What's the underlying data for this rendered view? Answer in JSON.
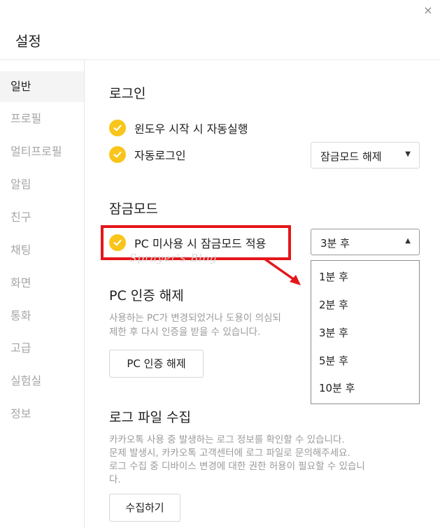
{
  "window": {
    "title": "설정",
    "close_icon": "×"
  },
  "sidebar": {
    "items": [
      {
        "label": "일반"
      },
      {
        "label": "프로필"
      },
      {
        "label": "멀티프로필"
      },
      {
        "label": "알림"
      },
      {
        "label": "친구"
      },
      {
        "label": "채팅"
      },
      {
        "label": "화면"
      },
      {
        "label": "통화"
      },
      {
        "label": "고급"
      },
      {
        "label": "실험실"
      },
      {
        "label": "정보"
      }
    ],
    "active": "일반"
  },
  "login": {
    "title": "로그인",
    "auto_run_label": "윈도우 시작 시 자동실행",
    "auto_login_label": "자동로그인",
    "auto_login_select": "잠금모드 해제"
  },
  "lock": {
    "title": "잠금모드",
    "pc_idle_label": "PC 미사용 시 잠금모드 적용",
    "select_value": "3분 후",
    "options": [
      "1분 후",
      "2분 후",
      "3분 후",
      "5분 후",
      "10분 후"
    ]
  },
  "pc_auth": {
    "title": "PC 인증 해제",
    "desc_line1": "사용하는 PC가 변경되었거나 도용이 의심되",
    "desc_line2": "제한 후 다시 인증을 받을 수 있습니다.",
    "button": "PC 인증 해제"
  },
  "log": {
    "title": "로그 파일 수집",
    "desc_line1": "카카오톡 사용 중 발생하는 로그 정보를 확인할 수 있습니다.",
    "desc_line2": "문제 발생시, 카카오톡 고객센터에 로그 파일로 문의해주세요.",
    "desc_line3": "로그 수집 중 디바이스 변경에 대한 권한 허용이 필요할 수 있습니",
    "desc_line4": "다.",
    "button": "수집하기"
  },
  "watermark": "Sprayer's Blog",
  "colors": {
    "accent_yellow": "#f9c51a",
    "highlight_red": "#e5161a",
    "active_bg": "#f4f4f4"
  }
}
